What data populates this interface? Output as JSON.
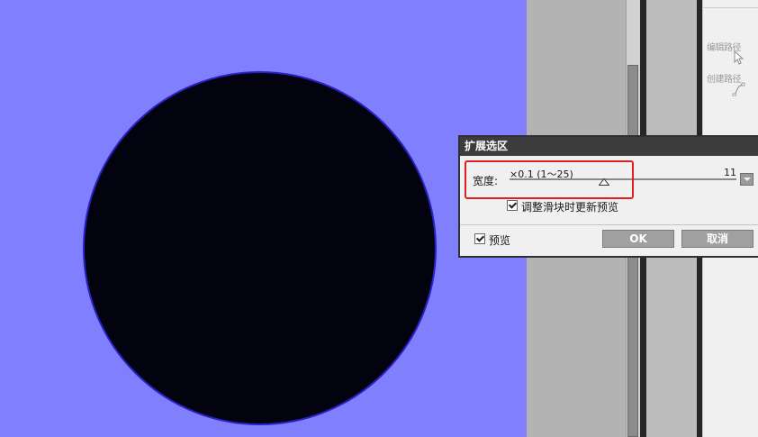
{
  "dialog": {
    "title": "扩展选区",
    "width_label": "宽度:",
    "range_label": "×0.1 (1～25)",
    "value": "11",
    "slider_value": 11,
    "slider_min": 1,
    "slider_max": 25,
    "live_preview_label": "调整滑块时更新预览",
    "live_preview_checked": true,
    "preview_label": "预览",
    "preview_checked": true,
    "ok_label": "OK",
    "cancel_label": "取消"
  },
  "tools": [
    {
      "label": "编辑路径",
      "icon": "cursor-arrow-icon"
    },
    {
      "label": "创建路径",
      "icon": "pen-path-icon"
    }
  ],
  "colors": {
    "canvas": "#8080ff",
    "shape_fill": "#03030f",
    "shape_stroke": "#2a22c8",
    "highlight": "#e02020"
  }
}
